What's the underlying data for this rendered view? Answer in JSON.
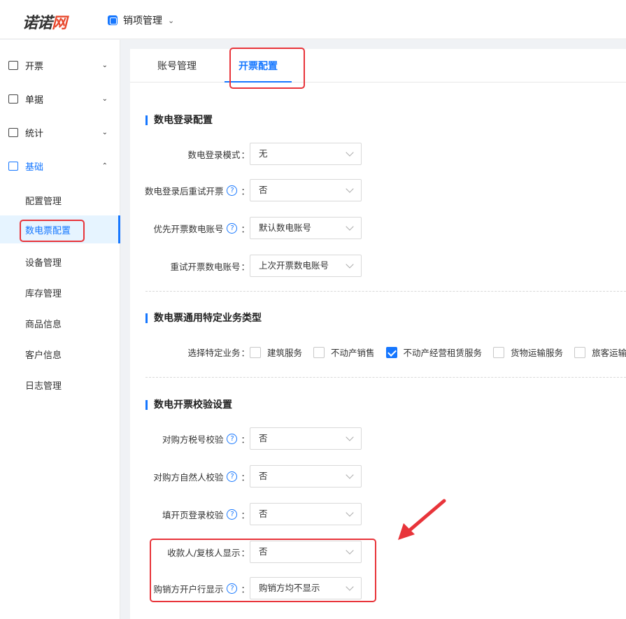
{
  "header": {
    "logo_main": "诺诺",
    "logo_accent": "网",
    "module_title": "销项管理"
  },
  "sidebar": {
    "groups": [
      {
        "label": "开票",
        "icon": "invoice-icon",
        "chevron": "⌄"
      },
      {
        "label": "单据",
        "icon": "document-icon",
        "chevron": "⌄"
      },
      {
        "label": "统计",
        "icon": "chart-icon",
        "chevron": "⌄"
      },
      {
        "label": "基础",
        "icon": "settings-list-icon",
        "chevron": "⌃"
      }
    ],
    "sub_items": [
      "配置管理",
      "数电票配置",
      "设备管理",
      "库存管理",
      "商品信息",
      "客户信息",
      "日志管理"
    ]
  },
  "tabs": [
    "账号管理",
    "开票配置"
  ],
  "sections": {
    "login": {
      "title": "数电登录配置",
      "rows": [
        {
          "label": "数电登录模式",
          "value": "无"
        },
        {
          "label": "数电登录后重试开票",
          "value": "否"
        },
        {
          "label": "优先开票数电账号",
          "value": "默认数电账号"
        },
        {
          "label": "重试开票数电账号",
          "value": "上次开票数电账号"
        }
      ]
    },
    "business": {
      "title": "数电票通用特定业务类型",
      "label": "选择特定业务",
      "options": [
        {
          "label": "建筑服务",
          "checked": false
        },
        {
          "label": "不动产销售",
          "checked": false
        },
        {
          "label": "不动产经营租赁服务",
          "checked": true
        },
        {
          "label": "货物运输服务",
          "checked": false
        },
        {
          "label": "旅客运输服务",
          "checked": false
        }
      ]
    },
    "check": {
      "title": "数电开票校验设置",
      "rows": [
        {
          "label": "对购方税号校验",
          "value": "否"
        },
        {
          "label": "对购方自然人校验",
          "value": "否"
        },
        {
          "label": "填开页登录校验",
          "value": "否"
        },
        {
          "label": "收款人/复核人显示",
          "value": "否"
        },
        {
          "label": "购销方开户行显示",
          "value": "购销方均不显示"
        }
      ]
    }
  },
  "help_glyph": "?",
  "colon": "："
}
